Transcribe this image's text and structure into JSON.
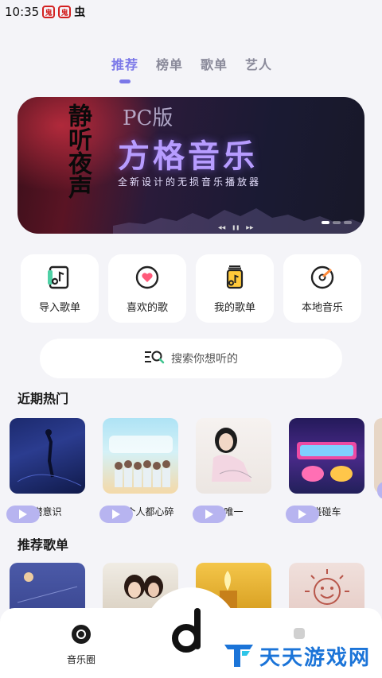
{
  "status_bar": {
    "time": "10:35",
    "icon1": "鬼",
    "icon2": "鬼",
    "icon3": "虫"
  },
  "tabs": [
    {
      "label": "推荐",
      "active": true
    },
    {
      "label": "榜单",
      "active": false
    },
    {
      "label": "歌单",
      "active": false
    },
    {
      "label": "艺人",
      "active": false
    }
  ],
  "banner": {
    "badge": "PC版",
    "title": "方格音乐",
    "subtitle": "全新设计的无损音乐播放器",
    "calligraphy": "静听夜声"
  },
  "quick": [
    {
      "label": "导入歌单",
      "icon": "import-playlist-icon"
    },
    {
      "label": "喜欢的歌",
      "icon": "heart-icon"
    },
    {
      "label": "我的歌单",
      "icon": "my-playlist-icon"
    },
    {
      "label": "本地音乐",
      "icon": "local-disc-icon"
    }
  ],
  "search": {
    "placeholder": "搜索你想听的"
  },
  "sections": {
    "hot": "近期热门",
    "recommend": "推荐歌单"
  },
  "hot": [
    {
      "name": "潜意识"
    },
    {
      "name": "让每个人都心碎"
    },
    {
      "name": "唯一"
    },
    {
      "name": "碰碰车"
    }
  ],
  "bottom_nav": {
    "circle_label": "音乐圈"
  },
  "watermark": {
    "text": "天天游戏网"
  },
  "colors": {
    "accent": "#7b78e8",
    "play_pill": "#b7b4f0"
  }
}
